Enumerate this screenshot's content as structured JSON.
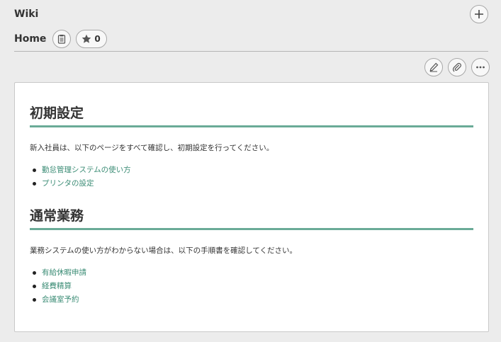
{
  "header": {
    "title": "Wiki",
    "page_name": "Home",
    "star_count": "0"
  },
  "sections": [
    {
      "heading": "初期設定",
      "description": "新入社員は、以下のページをすべて確認し、初期設定を行ってください。",
      "links": [
        "勤怠管理システムの使い方",
        "プリンタの設定"
      ]
    },
    {
      "heading": "通常業務",
      "description": "業務システムの使い方がわからない場合は、以下の手順書を確認してください。",
      "links": [
        "有給休暇申請",
        "経費精算",
        "会議室予約"
      ]
    }
  ],
  "icons": {
    "add": "plus-icon",
    "copy": "clipboard-icon",
    "star": "star-icon",
    "edit": "pencil-icon",
    "attach": "paperclip-icon",
    "more": "more-icon"
  },
  "colors": {
    "accent": "#6aab97",
    "link": "#3b8c75",
    "background": "#ececec"
  }
}
